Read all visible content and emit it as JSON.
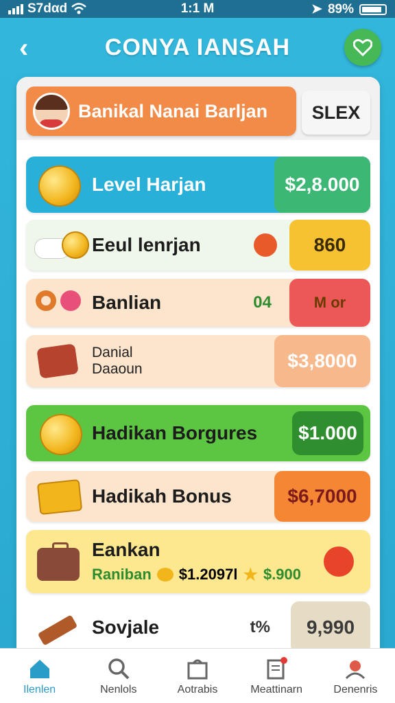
{
  "status_bar": {
    "carrier": "S7dαd",
    "time": "1:1 M",
    "battery": "89%"
  },
  "header": {
    "title": "CONYA IANSAH"
  },
  "profile": {
    "name": "Banikal Nanai Barljan",
    "select_label": "SLEX"
  },
  "rows": [
    {
      "label": "Level Harjan",
      "value": "$2,8.000"
    },
    {
      "label": "Eeul lenrjan",
      "value": "860"
    },
    {
      "label": "Banlian",
      "mid": "04",
      "value": "M or"
    },
    {
      "label_line1": "Danial",
      "label_line2": "Daaoun",
      "value": "$3,8000"
    },
    {
      "label": "Hadikan Borgures",
      "value": "$1.000"
    },
    {
      "label": "Hadikah Bonus",
      "value": "$6,7000"
    },
    {
      "label": "Eankan",
      "sub_label": "Raniban",
      "amount1": "$1.2097l",
      "amount2": "$.900"
    },
    {
      "label": "Sovjale",
      "mid": "t%",
      "value": "9,990"
    }
  ],
  "nav": [
    {
      "label": "Ilenlen",
      "icon": "home-icon"
    },
    {
      "label": "Nenlols",
      "icon": "search-icon"
    },
    {
      "label": "Aotrabis",
      "icon": "shop-icon"
    },
    {
      "label": "Meattinarn",
      "icon": "document-icon"
    },
    {
      "label": "Denenris",
      "icon": "profile-icon"
    }
  ],
  "colors": {
    "primary": "#2fb3d6",
    "accent_green": "#47b856",
    "orange": "#f28a48"
  }
}
